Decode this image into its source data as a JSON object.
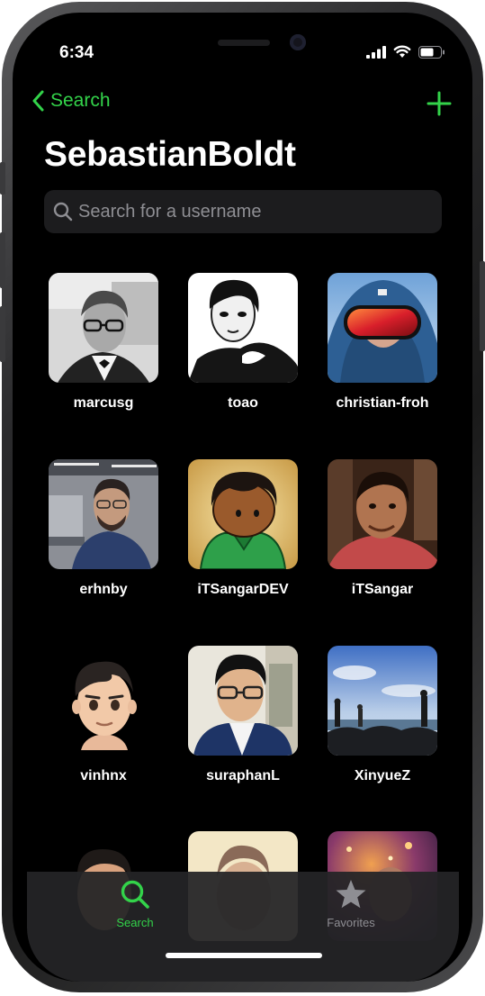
{
  "status_bar": {
    "time": "6:34"
  },
  "nav": {
    "back_label": "Search"
  },
  "title": "SebastianBoldt",
  "search": {
    "placeholder": "Search for a username",
    "value": ""
  },
  "users": [
    {
      "username": "marcusg",
      "avatar": "person-bw-glasses"
    },
    {
      "username": "toao",
      "avatar": "person-sketch"
    },
    {
      "username": "christian-froh",
      "avatar": "person-ski-goggles"
    },
    {
      "username": "erhnby",
      "avatar": "person-office"
    },
    {
      "username": "iTSangarDEV",
      "avatar": "cartoon-character"
    },
    {
      "username": "iTSangar",
      "avatar": "person-selfie"
    },
    {
      "username": "vinhnx",
      "avatar": "memoji"
    },
    {
      "username": "suraphanL",
      "avatar": "person-suit-glasses"
    },
    {
      "username": "XinyueZ",
      "avatar": "beach-scene"
    },
    {
      "username": "",
      "avatar": "memoji-partial"
    },
    {
      "username": "",
      "avatar": "person-partial"
    },
    {
      "username": "",
      "avatar": "night-lights-partial"
    }
  ],
  "tabs": [
    {
      "label": "Search",
      "icon": "magnifier-icon",
      "active": true
    },
    {
      "label": "Favorites",
      "icon": "star-icon",
      "active": false
    }
  ],
  "colors": {
    "accent": "#33d34a",
    "background": "#000000",
    "inactive_tab": "#8e8e93"
  }
}
